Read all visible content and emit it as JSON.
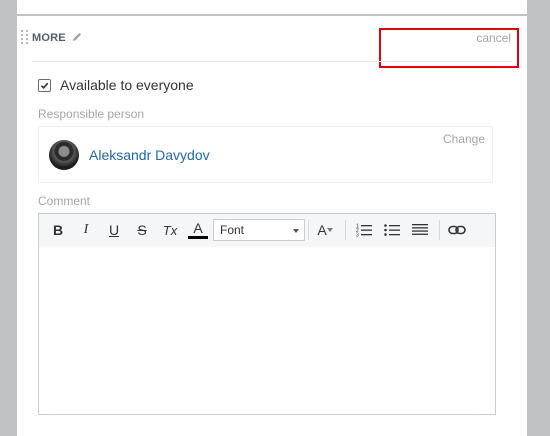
{
  "section": {
    "title": "MORE",
    "cancel_label": "cancel"
  },
  "availability": {
    "label": "Available to everyone",
    "checked": true
  },
  "responsible": {
    "label": "Responsible person",
    "person_name": "Aleksandr Davydov",
    "change_label": "Change"
  },
  "comment": {
    "label": "Comment",
    "toolbar": {
      "bold": "B",
      "italic": "I",
      "underline": "U",
      "strikethrough": "S",
      "clear_format": "Tx",
      "font_color": "A",
      "font_select_value": "Font",
      "font_size": "A",
      "ordered_list_icon": "ordered-list-icon",
      "bullet_list_icon": "bullet-list-icon",
      "align_icon": "align-justify-icon",
      "link_icon": "link-icon"
    },
    "body": ""
  },
  "colors": {
    "link": "#2067b0",
    "muted": "#a1a6ac",
    "highlight": "#e3000f",
    "background": "#bfc3c6"
  }
}
